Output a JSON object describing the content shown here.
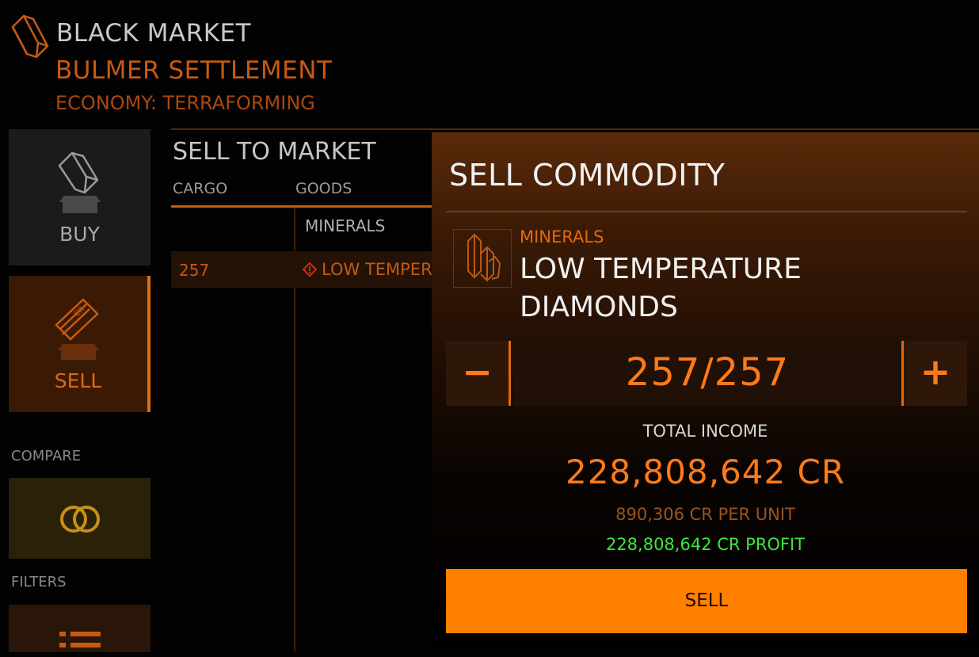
{
  "colors": {
    "accent": "#ff7a18",
    "accent_dim": "#c85a10",
    "profit": "#3ee63e",
    "sell_button": "#ff7f00"
  },
  "header": {
    "title": "BLACK MARKET",
    "station": "BULMER SETTLEMENT",
    "economy": "ECONOMY: TERRAFORMING",
    "icon": "commodity-crate-icon"
  },
  "nav": {
    "buy_label": "BUY",
    "buy_icon": "crate-buy-icon",
    "sell_label": "SELL",
    "sell_icon": "credits-sell-icon",
    "compare_label": "COMPARE",
    "compare_icon": "compare-rings-icon",
    "filters_label": "FILTERS",
    "filters_icon": "filter-list-icon"
  },
  "market": {
    "title": "SELL TO MARKET",
    "columns": [
      "CARGO",
      "GOODS"
    ],
    "category": "MINERALS",
    "rows": [
      {
        "cargo": "257",
        "goods": "LOW TEMPER",
        "icon": "illegal-warning-icon"
      }
    ]
  },
  "sell_panel": {
    "title": "SELL COMMODITY",
    "item_icon": "crystal-icon",
    "category": "MINERALS",
    "name_line1": "LOW TEMPERATURE",
    "name_line2": "DIAMONDS",
    "quantity": "257/257",
    "minus_label": "−",
    "plus_label": "+",
    "total_income_label": "TOTAL INCOME",
    "total_income": "228,808,642 CR",
    "per_unit": "890,306 CR PER UNIT",
    "profit": "228,808,642 CR PROFIT",
    "sell_label": "SELL"
  }
}
